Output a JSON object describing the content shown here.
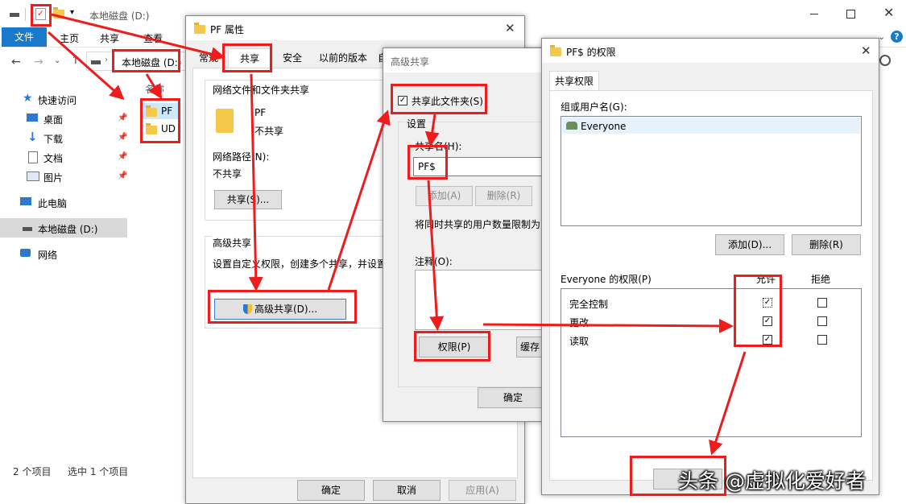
{
  "explorer": {
    "title": "本地磁盘 (D:)",
    "ribbon_tabs": [
      "文件",
      "主页",
      "共享",
      "查看"
    ],
    "address": "本地磁盘 (D:)",
    "column_header": "名称",
    "nav": {
      "quick_access": "快速访问",
      "desktop": "桌面",
      "downloads": "下载",
      "documents": "文档",
      "pictures": "图片",
      "this_pc": "此电脑",
      "local_disk": "本地磁盘 (D:)",
      "network": "网络"
    },
    "files": [
      "PF",
      "UD"
    ],
    "status_count": "2 个项目",
    "status_selected": "选中 1 个项目"
  },
  "props": {
    "title": "PF 属性",
    "tabs": [
      "常规",
      "共享",
      "安全",
      "以前的版本",
      "自"
    ],
    "section_network": "网络文件和文件夹共享",
    "folder_name": "PF",
    "share_state": "不共享",
    "network_path_label": "网络路径(N):",
    "network_path_value": "不共享",
    "share_button": "共享(S)...",
    "section_advanced": "高级共享",
    "advanced_desc": "设置自定义权限，创建多个共享，并设置",
    "advanced_button": "高级共享(D)...",
    "ok": "确定",
    "cancel": "取消",
    "apply": "应用(A)"
  },
  "advanced": {
    "title": "高级共享",
    "share_checkbox": "共享此文件夹(S)",
    "settings": "设置",
    "share_name_label": "共享名(H):",
    "share_name_value": "PF$",
    "add": "添加(A)",
    "remove": "删除(R)",
    "limit_text": "将同时共享的用户数量限制为",
    "comment_label": "注释(O):",
    "permissions_button": "权限(P)",
    "cache_button": "缓存",
    "ok": "确定"
  },
  "perm": {
    "title": "PF$ 的权限",
    "tab": "共享权限",
    "group_label": "组或用户名(G):",
    "users": [
      "Everyone"
    ],
    "add": "添加(D)...",
    "remove": "删除(R)",
    "perm_label": "Everyone 的权限(P)",
    "allow": "允许",
    "deny": "拒绝",
    "rows": [
      {
        "name": "完全控制",
        "allow": true,
        "deny": false
      },
      {
        "name": "更改",
        "allow": true,
        "deny": false
      },
      {
        "name": "读取",
        "allow": true,
        "deny": false
      }
    ]
  },
  "watermark": "头条 @虚拟化爱好者",
  "colors": {
    "annotation": "#ee1c1c",
    "ribbon_file": "#1979ca",
    "selection": "#cce8ff"
  }
}
